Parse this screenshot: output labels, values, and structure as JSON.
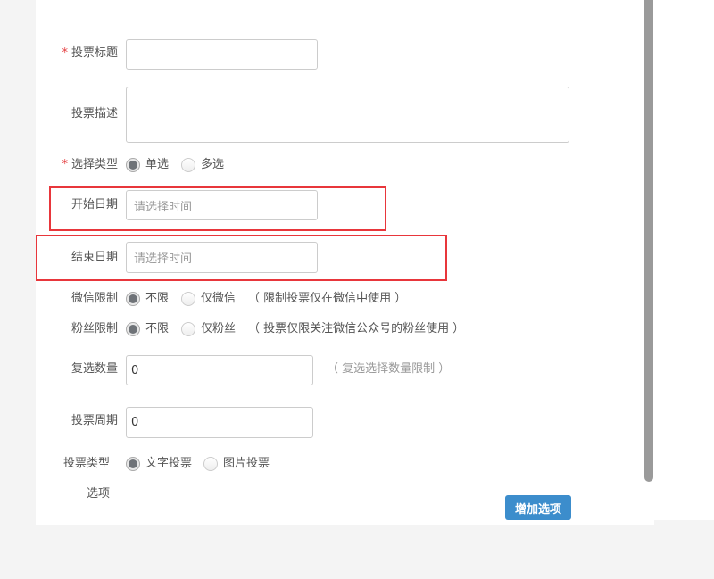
{
  "form": {
    "title_label": "投票标题",
    "desc_label": "投票描述",
    "select_type_label": "选择类型",
    "single": "单选",
    "multi": "多选",
    "start_label": "开始日期",
    "start_placeholder": "请选择时间",
    "end_label": "结束日期",
    "end_placeholder": "请选择时间",
    "wechat_label": "微信限制",
    "wechat_unlimited": "不限",
    "wechat_only": "仅微信",
    "wechat_hint": "（ 限制投票仅在微信中使用 ）",
    "fans_label": "粉丝限制",
    "fans_unlimited": "不限",
    "fans_only": "仅粉丝",
    "fans_hint": "（ 投票仅限关注微信公众号的粉丝使用 ）",
    "multi_count_label": "复选数量",
    "multi_count_value": "0",
    "multi_count_hint": "（ 复选选择数量限制 ）",
    "period_label": "投票周期",
    "period_value": "0",
    "vote_type_label": "投票类型",
    "text_vote": "文字投票",
    "image_vote": "图片投票",
    "options_label": "选项",
    "add_option": "增加选项"
  }
}
